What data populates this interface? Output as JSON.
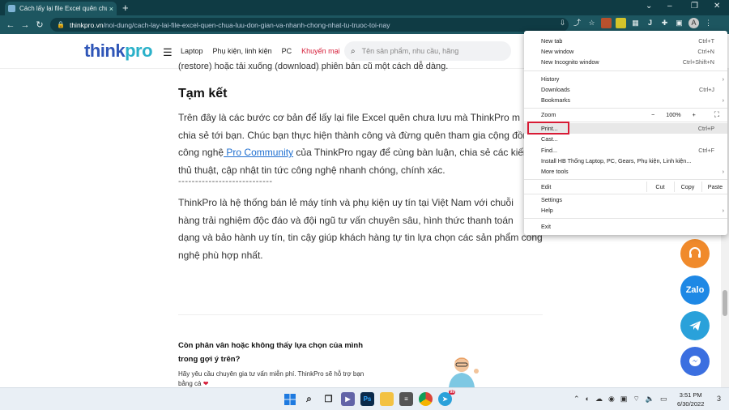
{
  "browser": {
    "tab_title": "Cách lấy lại file Excel quên chưa lư",
    "tab_close": "×",
    "new_tab": "+",
    "url_host": "thinkpro.vn",
    "url_path": "/noi-dung/cach-lay-lai-file-excel-quen-chua-luu-don-gian-va-nhanh-chong-nhat-tu-truoc-toi-nay"
  },
  "site": {
    "logo_think": "think",
    "logo_pro": "pro",
    "nav": [
      "Laptop",
      "Phụ kiện, linh kiện",
      "PC",
      "Khuyến mại"
    ],
    "search_placeholder": "Tên sản phẩm, nhu cầu, hãng"
  },
  "article": {
    "cut_line": "(restore) hoặc tải xuống (download) phiên bản cũ một cách dễ dàng.",
    "heading": "Tạm kết",
    "p1_a": "Trên đây là các bước cơ bản để lấy lại file Excel quên chưa lưu mà ThinkPro m",
    "p1_b": "chia sẻ tới bạn. Chúc bạn thực hiện thành công và đừng quên tham gia cộng đồng",
    "p1_c": "công nghệ",
    "p1_link": " Pro Community",
    "p1_d": " của ThinkPro ngay để cùng bàn luận, chia sẻ các kiến th",
    "p1_e": "thủ thuật, cập nhật tin tức công nghệ nhanh chóng, chính xác.",
    "divider": "----------------------------",
    "p2_a": "ThinkPro là hệ thống bán lẻ máy tính và phụ kiện uy tín tại Việt Nam với chuỗi",
    "p2_b": "hàng trải nghiệm độc đáo và đội ngũ tư vấn chuyên sâu, hình thức thanh toán",
    "p2_c": "dạng và bảo hành uy tín, tin cậy giúp khách hàng tự tin lựa chọn các sản phẩm công",
    "p2_d": "nghệ phù hợp nhất.",
    "consult_title": "Còn phân vân hoặc không thấy lựa chọn của mình trong gợi ý trên?",
    "consult_desc": "Hãy yêu cầu chuyên gia tư vấn miễn phí. ThinkPro sẽ hỗ trợ bạn bằng cả",
    "heart": "❤"
  },
  "contact": {
    "zalo": "Zalo"
  },
  "menu": {
    "new_tab": "New tab",
    "new_tab_sc": "Ctrl+T",
    "new_window": "New window",
    "new_window_sc": "Ctrl+N",
    "incognito": "New Incognito window",
    "incognito_sc": "Ctrl+Shift+N",
    "history": "History",
    "downloads": "Downloads",
    "downloads_sc": "Ctrl+J",
    "bookmarks": "Bookmarks",
    "zoom": "Zoom",
    "zoom_minus": "−",
    "zoom_value": "100%",
    "zoom_plus": "+",
    "print": "Print...",
    "print_sc": "Ctrl+P",
    "cast": "Cast...",
    "find": "Find...",
    "find_sc": "Ctrl+F",
    "install": "Install HB Thống Laptop, PC, Gears, Phụ kiện, Linh kiện...",
    "more_tools": "More tools",
    "edit": "Edit",
    "cut": "Cut",
    "copy": "Copy",
    "paste": "Paste",
    "settings": "Settings",
    "help": "Help",
    "exit": "Exit",
    "arrow": "›"
  },
  "taskbar": {
    "time": "3:51 PM",
    "date": "6/30/2022",
    "badge": "99"
  },
  "colors": {
    "accent_red": "#d81b35",
    "chrome_teal": "#1d5660",
    "brand_blue": "#2f56b8"
  }
}
